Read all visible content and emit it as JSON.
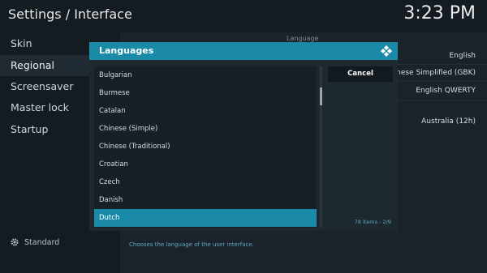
{
  "window": {
    "title": "Settings / Interface",
    "time": "3:23 PM"
  },
  "sidebar": {
    "items": [
      {
        "label": "Skin"
      },
      {
        "label": "Regional",
        "active": true
      },
      {
        "label": "Screensaver"
      },
      {
        "label": "Master lock"
      },
      {
        "label": "Startup"
      }
    ],
    "footer_label": "Standard",
    "footer_icon": "gear-icon"
  },
  "main": {
    "section_label": "Language",
    "values": [
      "English",
      "Chinese Simplified (GBK)",
      "English QWERTY",
      "Australia (12h)"
    ],
    "hint": "Chooses the language of the user interface."
  },
  "dialog": {
    "title": "Languages",
    "logo_icon": "kodi-logo-icon",
    "items": [
      "Bulgarian",
      "Burmese",
      "Catalan",
      "Chinese (Simple)",
      "Chinese (Traditional)",
      "Croatian",
      "Czech",
      "Danish",
      "Dutch"
    ],
    "selected_index": 8,
    "cancel_label": "Cancel",
    "count_text": "78 items",
    "count_page": "2/9",
    "accent_color": "#1b8aa8"
  }
}
